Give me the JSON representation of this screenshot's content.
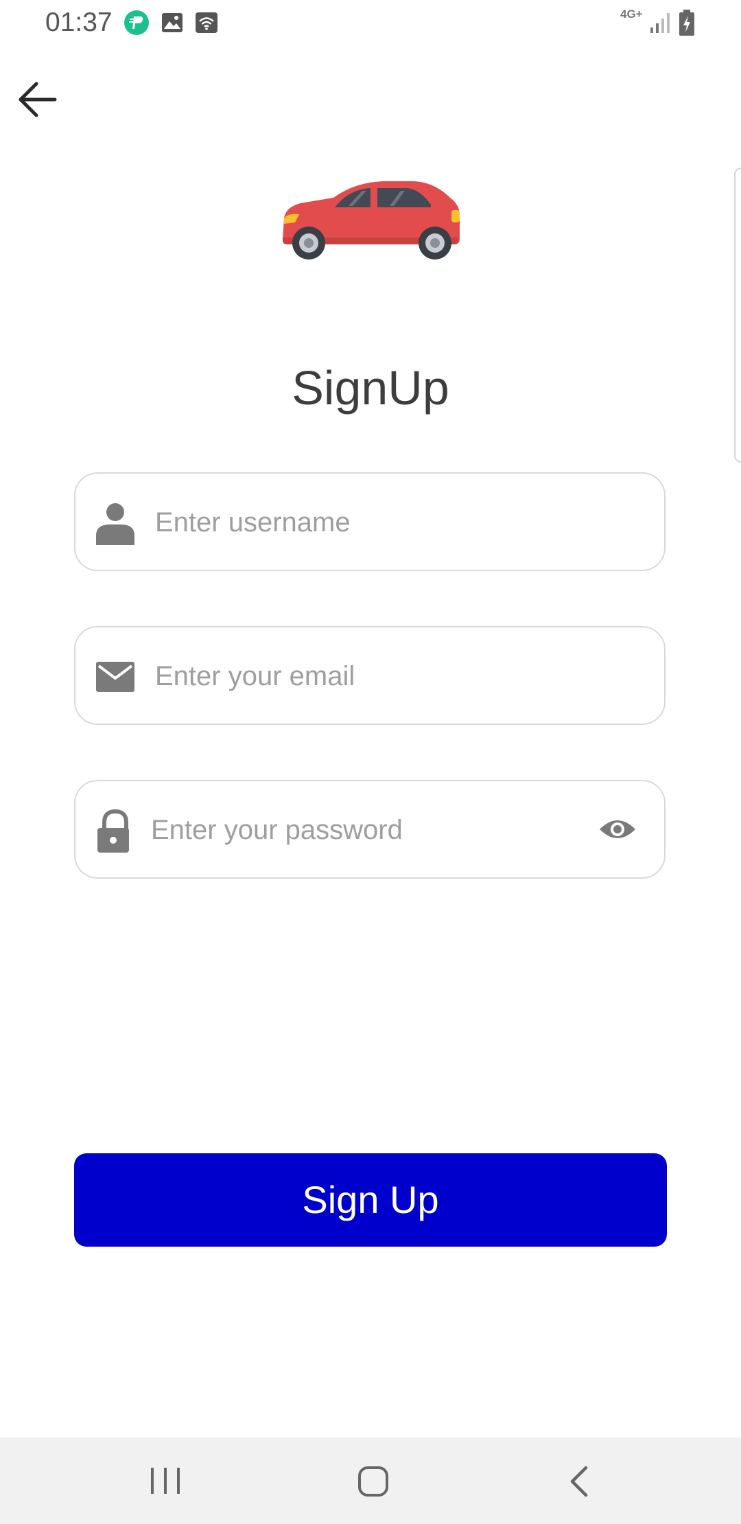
{
  "status_bar": {
    "time": "01:37",
    "network_type": "4G+",
    "icons": [
      "app-notification-icon",
      "gallery-icon",
      "wifi-calling-icon",
      "signal-icon",
      "battery-charging-icon"
    ]
  },
  "header": {
    "back_icon": "arrow-left-icon"
  },
  "logo": {
    "icon": "car-icon",
    "colors": {
      "body": "#e24c4c",
      "window": "#444a55",
      "wheel": "#3a3f45",
      "rim": "#c8ccd2",
      "light": "#f6c12a"
    }
  },
  "title": "SignUp",
  "form": {
    "username": {
      "placeholder": "Enter username",
      "icon": "person-icon"
    },
    "email": {
      "placeholder": "Enter your email",
      "icon": "envelope-icon"
    },
    "password": {
      "placeholder": "Enter your password",
      "icon": "lock-icon",
      "toggle_icon": "eye-icon"
    }
  },
  "submit": {
    "label": "Sign Up",
    "color": "#0000cc"
  },
  "nav_bar": {
    "icons": [
      "recents-icon",
      "home-icon",
      "back-icon"
    ]
  }
}
